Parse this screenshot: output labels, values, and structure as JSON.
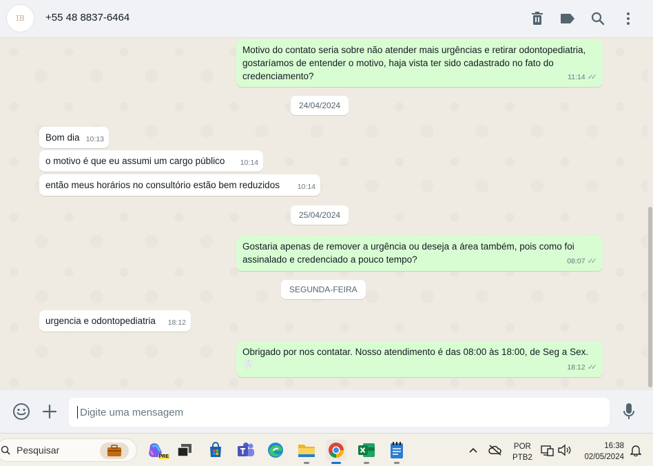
{
  "header": {
    "contact": "+55 48 8837-6464",
    "avatar_monogram": "IB"
  },
  "messages": [
    {
      "dir": "out",
      "text": "Motivo do contato seria sobre não atender mais urgências e retirar odontopediatria, gostaríamos de entender o motivo, haja vista ter sido cadastrado no fato do credenciamento?",
      "time": "11:14"
    },
    {
      "dir": "chip",
      "text": "24/04/2024"
    },
    {
      "dir": "in",
      "text": "Bom dia",
      "time": "10:13"
    },
    {
      "dir": "in",
      "text": "o motivo é que eu assumi um cargo público",
      "time": "10:14"
    },
    {
      "dir": "in",
      "text": "então meus horários no consultório estão bem reduzidos",
      "time": "10:14"
    },
    {
      "dir": "chip",
      "text": "25/04/2024"
    },
    {
      "dir": "out",
      "text": "Gostaria apenas de remover a urgência ou deseja a área também, pois como foi assinalado e credenciado a pouco tempo?",
      "time": "08:07"
    },
    {
      "dir": "chip",
      "text": "SEGUNDA-FEIRA"
    },
    {
      "dir": "in",
      "text": "urgencia e odontopediatria",
      "time": "18:12"
    },
    {
      "dir": "out",
      "text": "Obrigado por nos contatar. Nosso atendimento é das 08:00 às 18:00, de Seg a Sex.🦷",
      "time": "18:12"
    }
  ],
  "composer": {
    "placeholder": "Digite uma mensagem"
  },
  "taskbar": {
    "search_label": "Pesquisar",
    "lang_line1": "POR",
    "lang_line2": "PTB2",
    "time": "16:38",
    "date": "02/05/2024",
    "copilot_badge": "PRE"
  }
}
